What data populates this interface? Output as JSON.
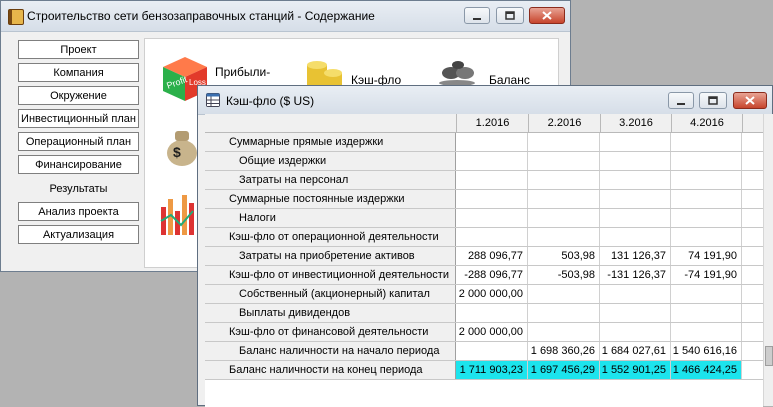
{
  "main_window": {
    "title": "Строительство сети бензозаправочных станций - Содержание",
    "nav": [
      "Проект",
      "Компания",
      "Окружение",
      "Инвестиционный план",
      "Операционный план",
      "Финансирование",
      "Результаты",
      "Анализ проекта",
      "Актуализация"
    ],
    "active_nav_index": 6,
    "features": [
      "Прибыли-",
      "Кэш-фло",
      "Баланс"
    ],
    "icons": [
      "notebook-icon",
      "profit-loss-cube-icon",
      "coins-stack-icon",
      "balance-stones-icon",
      "money-bag-icon",
      "bar-chart-icon"
    ]
  },
  "cashflow_window": {
    "title": "Кэш-фло ($ US)",
    "columns": [
      "1.2016",
      "2.2016",
      "3.2016",
      "4.2016"
    ],
    "rows": [
      {
        "label": "Суммарные прямые издержки",
        "indent": 1,
        "values": [
          "",
          "",
          "",
          ""
        ]
      },
      {
        "label": "Общие издержки",
        "indent": 2,
        "values": [
          "",
          "",
          "",
          ""
        ]
      },
      {
        "label": "Затраты на персонал",
        "indent": 2,
        "values": [
          "",
          "",
          "",
          ""
        ]
      },
      {
        "label": "Суммарные постоянные издержки",
        "indent": 1,
        "values": [
          "",
          "",
          "",
          ""
        ]
      },
      {
        "label": "Налоги",
        "indent": 2,
        "values": [
          "",
          "",
          "",
          ""
        ]
      },
      {
        "label": "Кэш-фло от операционной деятельности",
        "indent": 1,
        "values": [
          "",
          "",
          "",
          ""
        ]
      },
      {
        "label": "Затраты на приобретение активов",
        "indent": 2,
        "values": [
          "288 096,77",
          "503,98",
          "131 126,37",
          "74 191,90"
        ]
      },
      {
        "label": "Кэш-фло от инвестиционной деятельности",
        "indent": 1,
        "values": [
          "-288 096,77",
          "-503,98",
          "-131 126,37",
          "-74 191,90"
        ]
      },
      {
        "label": "Собственный (акционерный) капитал",
        "indent": 2,
        "values": [
          "2 000 000,00",
          "",
          "",
          ""
        ]
      },
      {
        "label": "Выплаты дивидендов",
        "indent": 2,
        "values": [
          "",
          "",
          "",
          ""
        ]
      },
      {
        "label": "Кэш-фло от финансовой деятельности",
        "indent": 1,
        "values": [
          "2 000 000,00",
          "",
          "",
          ""
        ]
      },
      {
        "label": "Баланс наличности на начало периода",
        "indent": 2,
        "values": [
          "",
          "1 698 360,26",
          "1 684 027,61",
          "1 540 616,16"
        ]
      },
      {
        "label": "Баланс наличности на конец периода",
        "indent": 1,
        "values": [
          "1 711 903,23",
          "1 697 456,29",
          "1 552 901,25",
          "1 466 424,25"
        ]
      }
    ],
    "highlight_row_index": 12,
    "highlight_color": "#1ce4ed"
  },
  "window_controls": [
    "minimize-icon",
    "maximize-icon",
    "close-icon"
  ]
}
